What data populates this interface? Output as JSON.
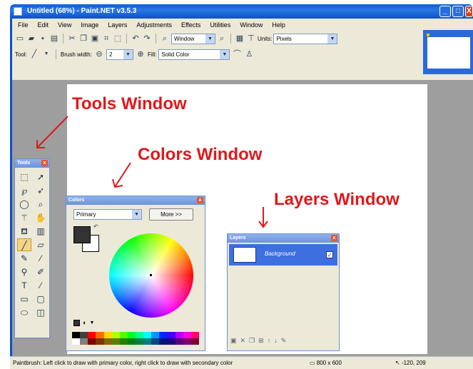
{
  "window": {
    "title": "Untitled (68%) - Paint.NET v3.5.3",
    "buttons": [
      "_",
      "□",
      "X"
    ]
  },
  "menu": [
    "File",
    "Edit",
    "View",
    "Image",
    "Layers",
    "Adjustments",
    "Effects",
    "Utilities",
    "Window",
    "Help"
  ],
  "toolbar1": {
    "zoom_value": "Window",
    "units_label": "Units:",
    "units_value": "Pixels"
  },
  "toolbar2": {
    "tool_label": "Tool:",
    "brush_width_label": "Brush width:",
    "brush_width_value": "2",
    "fill_label": "Fill:",
    "fill_value": "Solid Color"
  },
  "annotations": {
    "tools": "Tools Window",
    "colors": "Colors Window",
    "layers": "Layers Window"
  },
  "tools_window": {
    "title": "Tools",
    "close": "x",
    "icons": [
      "select-rect-icon",
      "move-selection-icon",
      "lasso-icon",
      "move-pixels-icon",
      "ellipse-select-icon",
      "zoom-icon",
      "magic-wand-icon",
      "pan-icon",
      "paint-bucket-icon",
      "gradient-icon",
      "paintbrush-icon",
      "eraser-icon",
      "pencil-icon",
      "color-picker-icon",
      "clone-stamp-icon",
      "recolor-icon",
      "text-icon",
      "line-curve-icon",
      "rectangle-icon",
      "rounded-rect-icon",
      "ellipse-icon",
      "freeform-shape-icon"
    ]
  },
  "colors_window": {
    "title": "Colors",
    "close": "x",
    "palette_select": "Primary",
    "more_button": "More >>",
    "primary_color": "#333333",
    "secondary_color": "#ffffff",
    "palette": [
      "#000000",
      "#404040",
      "#ff0000",
      "#ff6a00",
      "#ffd800",
      "#b6ff00",
      "#4cff00",
      "#00ff21",
      "#00ff90",
      "#00ffff",
      "#0094ff",
      "#0026ff",
      "#4800ff",
      "#b200ff",
      "#ff00dc",
      "#ff006e",
      "#ffffff",
      "#808080",
      "#7f0000",
      "#7f3300",
      "#7f6a00",
      "#5b7f00",
      "#267f00",
      "#007f0e",
      "#007f46",
      "#007f7f",
      "#004a7f",
      "#00137f",
      "#21007f",
      "#57007f",
      "#7f006e",
      "#7f0037"
    ]
  },
  "layers_window": {
    "title": "Layers",
    "close": "x",
    "layer_name": "Background",
    "layer_visible": "✓"
  },
  "status": {
    "hint": "Paintbrush: Left click to draw with primary color, right click to draw with secondary color",
    "image_size": "800 x 600",
    "cursor_pos": "-120, 209"
  }
}
